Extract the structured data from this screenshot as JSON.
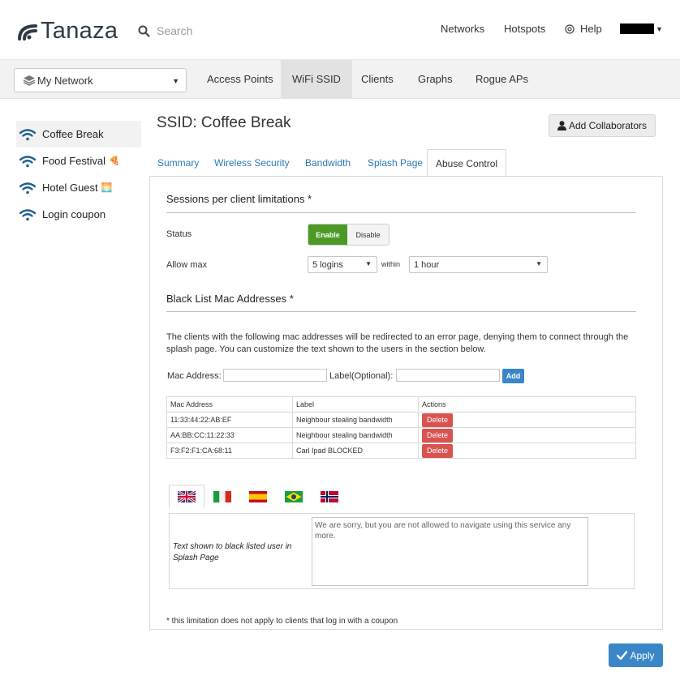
{
  "header": {
    "logo_text": "Tanaza",
    "search_placeholder": "Search",
    "nav": {
      "networks": "Networks",
      "hotspots": "Hotspots",
      "help": "Help"
    }
  },
  "subbar": {
    "network_selected": "My Network",
    "tabs": [
      "Access Points",
      "WiFi SSID",
      "Clients",
      "Graphs",
      "Rogue APs"
    ],
    "active_tab": "WiFi SSID"
  },
  "sidebar": {
    "items": [
      {
        "label": "Coffee Break",
        "emoji": ""
      },
      {
        "label": "Food Festival",
        "emoji": "🍕"
      },
      {
        "label": "Hotel Guest",
        "emoji": "🌅"
      },
      {
        "label": "Login coupon",
        "emoji": ""
      }
    ]
  },
  "ssid": {
    "title": "SSID: Coffee Break",
    "add_collaborators": "Add Collaborators",
    "tabs": [
      "Summary",
      "Wireless Security",
      "Bandwidth",
      "Splash Page",
      "Abuse Control"
    ],
    "active_tab": "Abuse Control"
  },
  "sessions": {
    "title": "Sessions per client limitations *",
    "status_label": "Status",
    "enable": "Enable",
    "disable": "Disable",
    "allow_max_label": "Allow max",
    "logins_value": "5 logins",
    "within": "within",
    "period_value": "1 hour"
  },
  "blacklist": {
    "title": "Black List Mac Addresses *",
    "description": "The clients with the following mac addresses will be redirected to an error page, denying them to connect through the splash page. You can customize the text shown to the users in the section below.",
    "mac_label": "Mac Address:",
    "label_optional": "Label(Optional):",
    "add": "Add",
    "columns": [
      "Mac Address",
      "Label",
      "Actions"
    ],
    "rows": [
      {
        "mac": "11:33:44:22:AB:EF",
        "label": "Neighbour stealing bandwidth",
        "action": "Delete"
      },
      {
        "mac": "AA:BB:CC:11:22:33",
        "label": "Neighbour stealing bandwidth",
        "action": "Delete"
      },
      {
        "mac": "F3:F2:F1:CA:68:11",
        "label": "Carl Ipad BLOCKED",
        "action": "Delete"
      }
    ]
  },
  "splash_text": {
    "languages": [
      "uk-flag-icon",
      "italy-flag-icon",
      "spain-flag-icon",
      "brazil-flag-icon",
      "norway-flag-icon"
    ],
    "field_label": "Text shown to black listed user in Splash Page",
    "message": "We are sorry, but you are not allowed to navigate using this service any more."
  },
  "footnote": "* this limitation does not apply to clients that log in with a coupon",
  "apply": "Apply",
  "colors": {
    "primary": "#3a86c8",
    "enable_green": "#4a9a25",
    "delete_red": "#d9534f",
    "link_blue": "#2a7ab8"
  }
}
